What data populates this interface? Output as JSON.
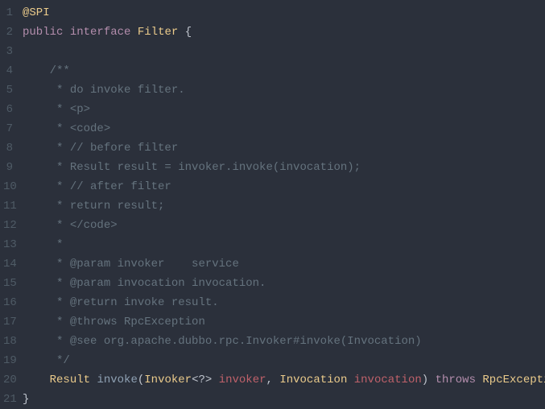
{
  "lines": [
    {
      "n": 1,
      "tokens": [
        [
          "annotation",
          "@SPI"
        ]
      ]
    },
    {
      "n": 2,
      "tokens": [
        [
          "keyword",
          "public"
        ],
        [
          "plain",
          " "
        ],
        [
          "keyword",
          "interface"
        ],
        [
          "plain",
          " "
        ],
        [
          "type",
          "Filter"
        ],
        [
          "plain",
          " "
        ],
        [
          "punct",
          "{"
        ]
      ]
    },
    {
      "n": 3,
      "tokens": []
    },
    {
      "n": 4,
      "tokens": [
        [
          "plain",
          "    "
        ],
        [
          "comment",
          "/**"
        ]
      ]
    },
    {
      "n": 5,
      "tokens": [
        [
          "plain",
          "    "
        ],
        [
          "comment",
          " * do invoke filter."
        ]
      ]
    },
    {
      "n": 6,
      "tokens": [
        [
          "plain",
          "    "
        ],
        [
          "comment",
          " * <p>"
        ]
      ]
    },
    {
      "n": 7,
      "tokens": [
        [
          "plain",
          "    "
        ],
        [
          "comment",
          " * <code>"
        ]
      ]
    },
    {
      "n": 8,
      "tokens": [
        [
          "plain",
          "    "
        ],
        [
          "comment",
          " * // before filter"
        ]
      ]
    },
    {
      "n": 9,
      "tokens": [
        [
          "plain",
          "    "
        ],
        [
          "comment",
          " * Result result = invoker.invoke(invocation);"
        ]
      ]
    },
    {
      "n": 10,
      "tokens": [
        [
          "plain",
          "    "
        ],
        [
          "comment",
          " * // after filter"
        ]
      ]
    },
    {
      "n": 11,
      "tokens": [
        [
          "plain",
          "    "
        ],
        [
          "comment",
          " * return result;"
        ]
      ]
    },
    {
      "n": 12,
      "tokens": [
        [
          "plain",
          "    "
        ],
        [
          "comment",
          " * </code>"
        ]
      ]
    },
    {
      "n": 13,
      "tokens": [
        [
          "plain",
          "    "
        ],
        [
          "comment",
          " *"
        ]
      ]
    },
    {
      "n": 14,
      "tokens": [
        [
          "plain",
          "    "
        ],
        [
          "comment",
          " * @param invoker    service"
        ]
      ]
    },
    {
      "n": 15,
      "tokens": [
        [
          "plain",
          "    "
        ],
        [
          "comment",
          " * @param invocation invocation."
        ]
      ]
    },
    {
      "n": 16,
      "tokens": [
        [
          "plain",
          "    "
        ],
        [
          "comment",
          " * @return invoke result."
        ]
      ]
    },
    {
      "n": 17,
      "tokens": [
        [
          "plain",
          "    "
        ],
        [
          "comment",
          " * @throws RpcException"
        ]
      ]
    },
    {
      "n": 18,
      "tokens": [
        [
          "plain",
          "    "
        ],
        [
          "comment",
          " * @see org.apache.dubbo.rpc.Invoker#invoke(Invocation)"
        ]
      ]
    },
    {
      "n": 19,
      "tokens": [
        [
          "plain",
          "    "
        ],
        [
          "comment",
          " */"
        ]
      ]
    },
    {
      "n": 20,
      "tokens": [
        [
          "plain",
          "    "
        ],
        [
          "type",
          "Result"
        ],
        [
          "plain",
          " "
        ],
        [
          "method",
          "invoke"
        ],
        [
          "punct",
          "("
        ],
        [
          "type",
          "Invoker"
        ],
        [
          "punct",
          "<?>"
        ],
        [
          "plain",
          " "
        ],
        [
          "param",
          "invoker"
        ],
        [
          "punct",
          ","
        ],
        [
          "plain",
          " "
        ],
        [
          "type",
          "Invocation"
        ],
        [
          "plain",
          " "
        ],
        [
          "param",
          "invocation"
        ],
        [
          "punct",
          ")"
        ],
        [
          "plain",
          " "
        ],
        [
          "keyword",
          "throws"
        ],
        [
          "plain",
          " "
        ],
        [
          "type",
          "RpcException"
        ],
        [
          "punct",
          ";"
        ]
      ]
    },
    {
      "n": 21,
      "tokens": [
        [
          "punct",
          "}"
        ]
      ]
    }
  ]
}
